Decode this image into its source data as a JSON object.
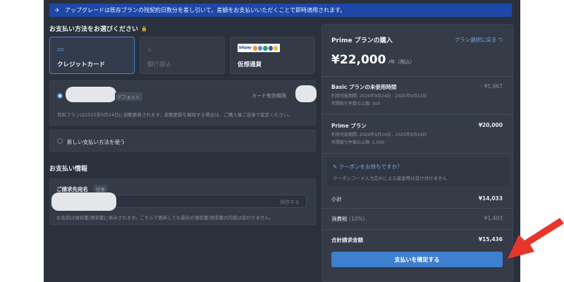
{
  "banner": {
    "text": "アップグレードは既存プランの残契約日数分を差し引いて、差額をお支払いいただくことで即時適用されます。"
  },
  "payment_method": {
    "title": "お支払い方法をお選びください",
    "options": [
      {
        "label": "クレジットカード",
        "icon": "credit-card-icon",
        "selected": true
      },
      {
        "label": "銀行振込",
        "icon": "bank-icon",
        "disabled": true
      },
      {
        "label": "仮想通貨",
        "icon": "crypto-logos-icon",
        "logo_text": "bitpay"
      }
    ],
    "saved_card": {
      "default_tag": "デフォルト",
      "expiry_label": "カード有効期限",
      "note": "有料プランは2025年9月24日に自動更新されます。自動更新を解除する場合は、ご購入後ご自身で設定ください。"
    },
    "new_method_label": "新しい支払い方法を使う"
  },
  "billing_info": {
    "title": "お支払い情報",
    "name_label": "ご請求先宛名",
    "required_tag": "任意",
    "save_label": "保存する",
    "note": "お名前は領収書/請求書に表示されます。こちらで更新しても過去の領収書/請求書の内容は変わりません。"
  },
  "purchase": {
    "title": "Prime プランの購入",
    "back_label": "プラン選択に戻る",
    "price": "¥22,000",
    "price_unit": "/年（税込）",
    "basic_unused": {
      "title": "Basic プランの未使用時間",
      "period": "利用可能期間: 2024年9月24日 - 2025年9月22日",
      "limit": "年間取引件数の上限: 300",
      "value": "- ¥5,967"
    },
    "prime": {
      "title": "Prime プラン",
      "period": "利用可能期間: 2024年9月24日 - 2025年9月24日",
      "limit": "年間取引件数の上限: 2,000",
      "value": "¥20,000"
    },
    "coupon_link": "クーポンをお持ちですか？",
    "coupon_note": "クーポンコード入力忘れによる返金等は受け付けません",
    "subtotal_label": "小計",
    "subtotal_value": "¥14,033",
    "tax_label": "消費税",
    "tax_rate": "(10%)",
    "tax_value": "¥1,403",
    "total_label": "合計請求金額",
    "total_value": "¥15,436",
    "confirm_label": "支払いを確定する"
  },
  "colors": {
    "accent": "#3f7fcf",
    "banner": "#1e47a8",
    "arrow": "#e8352b"
  }
}
